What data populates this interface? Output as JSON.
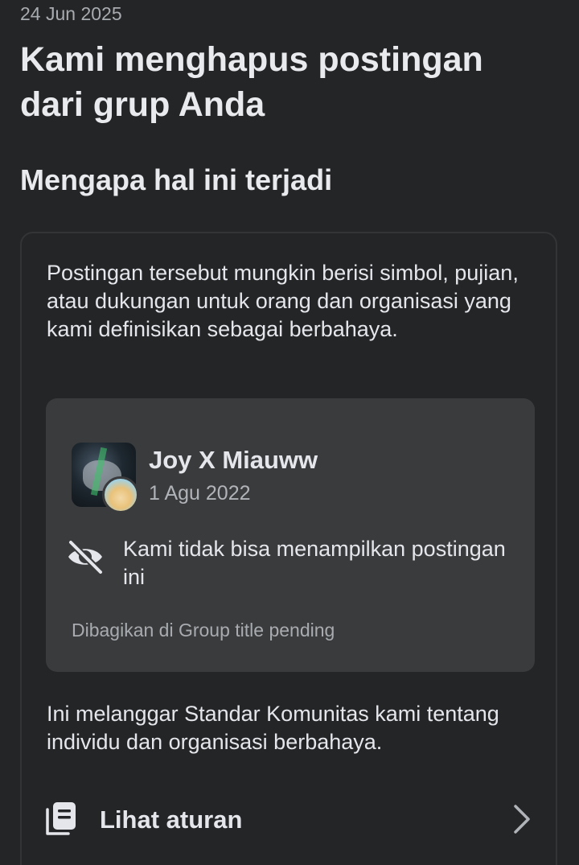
{
  "header": {
    "date": "24 Jun 2025",
    "title": "Kami menghapus postingan dari grup Anda",
    "section_title": "Mengapa hal ini terjadi"
  },
  "card": {
    "reason": "Postingan tersebut mungkin berisi simbol, pujian, atau dukungan untuk orang dan organisasi yang kami definisikan sebagai berbahaya.",
    "post": {
      "author": "Joy X Miauww",
      "date": "1 Agu 2022",
      "hidden_message": "Kami tidak bisa menampilkan postingan ini",
      "hidden_icon": "eye-off-icon",
      "shared_in": "Dibagikan di Group title pending"
    },
    "violation": "Ini melanggar Standar Komunitas kami tentang individu dan organisasi berbahaya.",
    "rules_link": {
      "label": "Lihat aturan",
      "icon": "document-stack-icon",
      "chevron": "chevron-right-icon"
    }
  },
  "colors": {
    "background": "#242526",
    "post_box": "#3a3b3c",
    "primary_text": "#e4e6eb",
    "secondary_text": "#b0b3b8"
  }
}
